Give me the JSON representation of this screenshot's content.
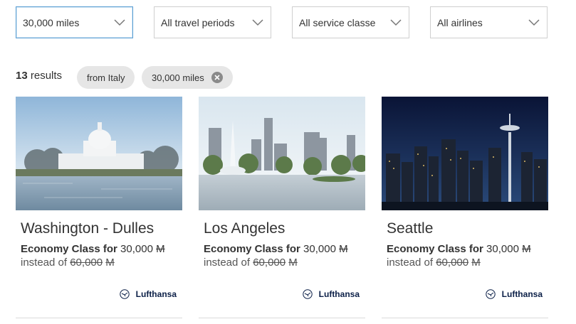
{
  "filters": [
    {
      "label": "30,000 miles",
      "active": true
    },
    {
      "label": "All travel periods",
      "active": false
    },
    {
      "label": "All service classe",
      "active": false
    },
    {
      "label": "All airlines",
      "active": false
    }
  ],
  "results": {
    "count": "13",
    "label": "results"
  },
  "chips": [
    {
      "label": "from Italy",
      "removable": false
    },
    {
      "label": "30,000 miles",
      "removable": true
    }
  ],
  "cards": [
    {
      "city": "Washington - Dulles",
      "class_label": "Economy Class for",
      "miles": "30,000",
      "instead_label": "instead of",
      "original_miles": "60,000",
      "miles_symbol": "M",
      "airline": "Lufthansa"
    },
    {
      "city": "Los Angeles",
      "class_label": "Economy Class for",
      "miles": "30,000",
      "instead_label": "instead of",
      "original_miles": "60,000",
      "miles_symbol": "M",
      "airline": "Lufthansa"
    },
    {
      "city": "Seattle",
      "class_label": "Economy Class for",
      "miles": "30,000",
      "instead_label": "instead of",
      "original_miles": "60,000",
      "miles_symbol": "M",
      "airline": "Lufthansa"
    }
  ],
  "icons": {
    "dropdown": "chevron-down-icon",
    "chip_remove": "close-icon",
    "airline_logo": "lufthansa-crane-icon"
  },
  "colors": {
    "active_border": "#5a9fd4",
    "chip_bg": "#e6e6e6",
    "airline_text": "#0b1f47"
  }
}
